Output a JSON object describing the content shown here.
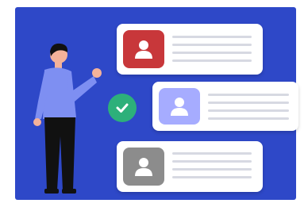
{
  "colors": {
    "background": "#2e48c8",
    "card_red_avatar": "#c8373a",
    "card_purple_avatar": "#a6acff",
    "card_gray_avatar": "#8c8c8c",
    "check_green": "#2db07a",
    "shirt": "#7e8ff2",
    "pants": "#111111",
    "skin": "#f4b29a",
    "hair": "#111111"
  },
  "illustration": {
    "person": "person-pointing",
    "check_icon": "check-circle-icon",
    "cards": [
      {
        "avatar_icon": "user-icon",
        "avatar_color": "red",
        "lines": 3
      },
      {
        "avatar_icon": "user-icon",
        "avatar_color": "purple",
        "lines": 3,
        "selected": true
      },
      {
        "avatar_icon": "user-icon",
        "avatar_color": "gray",
        "lines": 3
      }
    ]
  }
}
